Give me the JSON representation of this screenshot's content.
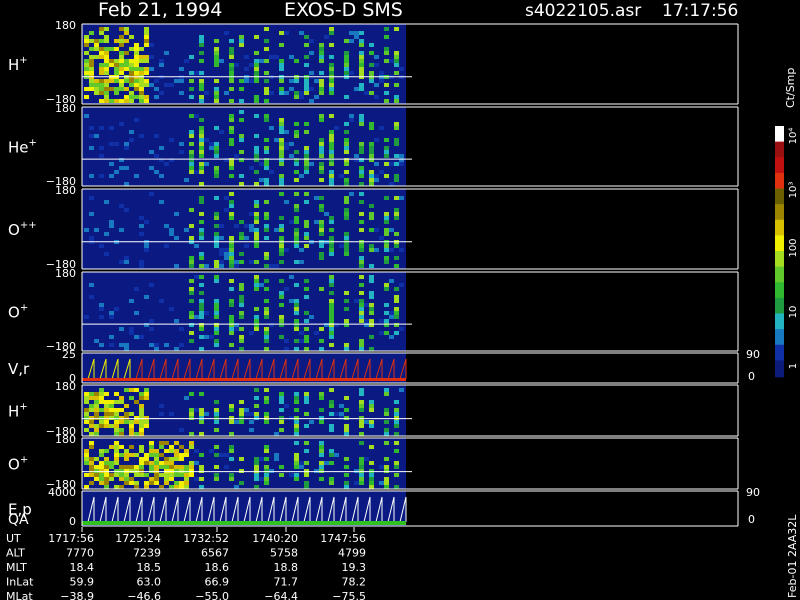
{
  "header": {
    "date": "Feb 21, 1994",
    "mission": "EXOS-D SMS",
    "file": "s4022105.asr",
    "time": "17:17:56"
  },
  "chart_data": {
    "type": "heatmap",
    "panels": [
      {
        "id": "h-plus",
        "label": "H",
        "sup": "+",
        "ymax": "180",
        "ymin": "−180"
      },
      {
        "id": "he-plus",
        "label": "He",
        "sup": "+",
        "ymax": "180",
        "ymin": "−180"
      },
      {
        "id": "o-plus-plus",
        "label": "O",
        "sup": "++",
        "ymax": "180",
        "ymin": "−180"
      },
      {
        "id": "o-plus",
        "label": "O",
        "sup": "+",
        "ymax": "180",
        "ymin": "−180"
      },
      {
        "id": "v-r",
        "label": "V,r",
        "sup": "",
        "ymax": "25",
        "ymin": "0",
        "right_top": "90",
        "right_bottom": "0",
        "line": true
      },
      {
        "id": "h-plus-2",
        "label": "H",
        "sup": "+",
        "ymax": "180",
        "ymin": "−180"
      },
      {
        "id": "o-plus-2",
        "label": "O",
        "sup": "+",
        "ymax": "180",
        "ymin": "−180"
      },
      {
        "id": "e-p-qa",
        "label": "E,p",
        "label2": "QA",
        "sup": "",
        "ymax": "4000",
        "ymin": "0",
        "right_top": "90",
        "right_bottom": "0",
        "line": true
      }
    ],
    "colorbar": {
      "unit": "Ct/Smp",
      "ticks": [
        "1",
        "10",
        "100",
        "10³",
        "10⁴"
      ],
      "colors": [
        "#0c1a7a",
        "#1030a8",
        "#1878c0",
        "#22b4c0",
        "#209a40",
        "#30b830",
        "#60c82a",
        "#a4dc20",
        "#f0f000",
        "#d8c000",
        "#9a8400",
        "#6a6000",
        "#e03010",
        "#c01010",
        "#9a1010",
        "#ffffff"
      ]
    },
    "footer": {
      "rows": [
        {
          "label": "UT",
          "values": [
            "1717:56",
            "1725:24",
            "1732:52",
            "1740:20",
            "1747:56"
          ]
        },
        {
          "label": "ALT",
          "values": [
            "7770",
            "7239",
            "6567",
            "5758",
            "4799"
          ]
        },
        {
          "label": "MLT",
          "values": [
            "18.4",
            "18.5",
            "18.6",
            "18.8",
            "19.3"
          ]
        },
        {
          "label": "InLat",
          "values": [
            "59.9",
            "63.0",
            "66.9",
            "71.7",
            "78.2"
          ]
        },
        {
          "label": "MLat",
          "values": [
            "−38.9",
            "−46.6",
            "−55.0",
            "−64.4",
            "−75.5"
          ]
        }
      ],
      "stamp": "Feb-01 2AA32L"
    }
  }
}
